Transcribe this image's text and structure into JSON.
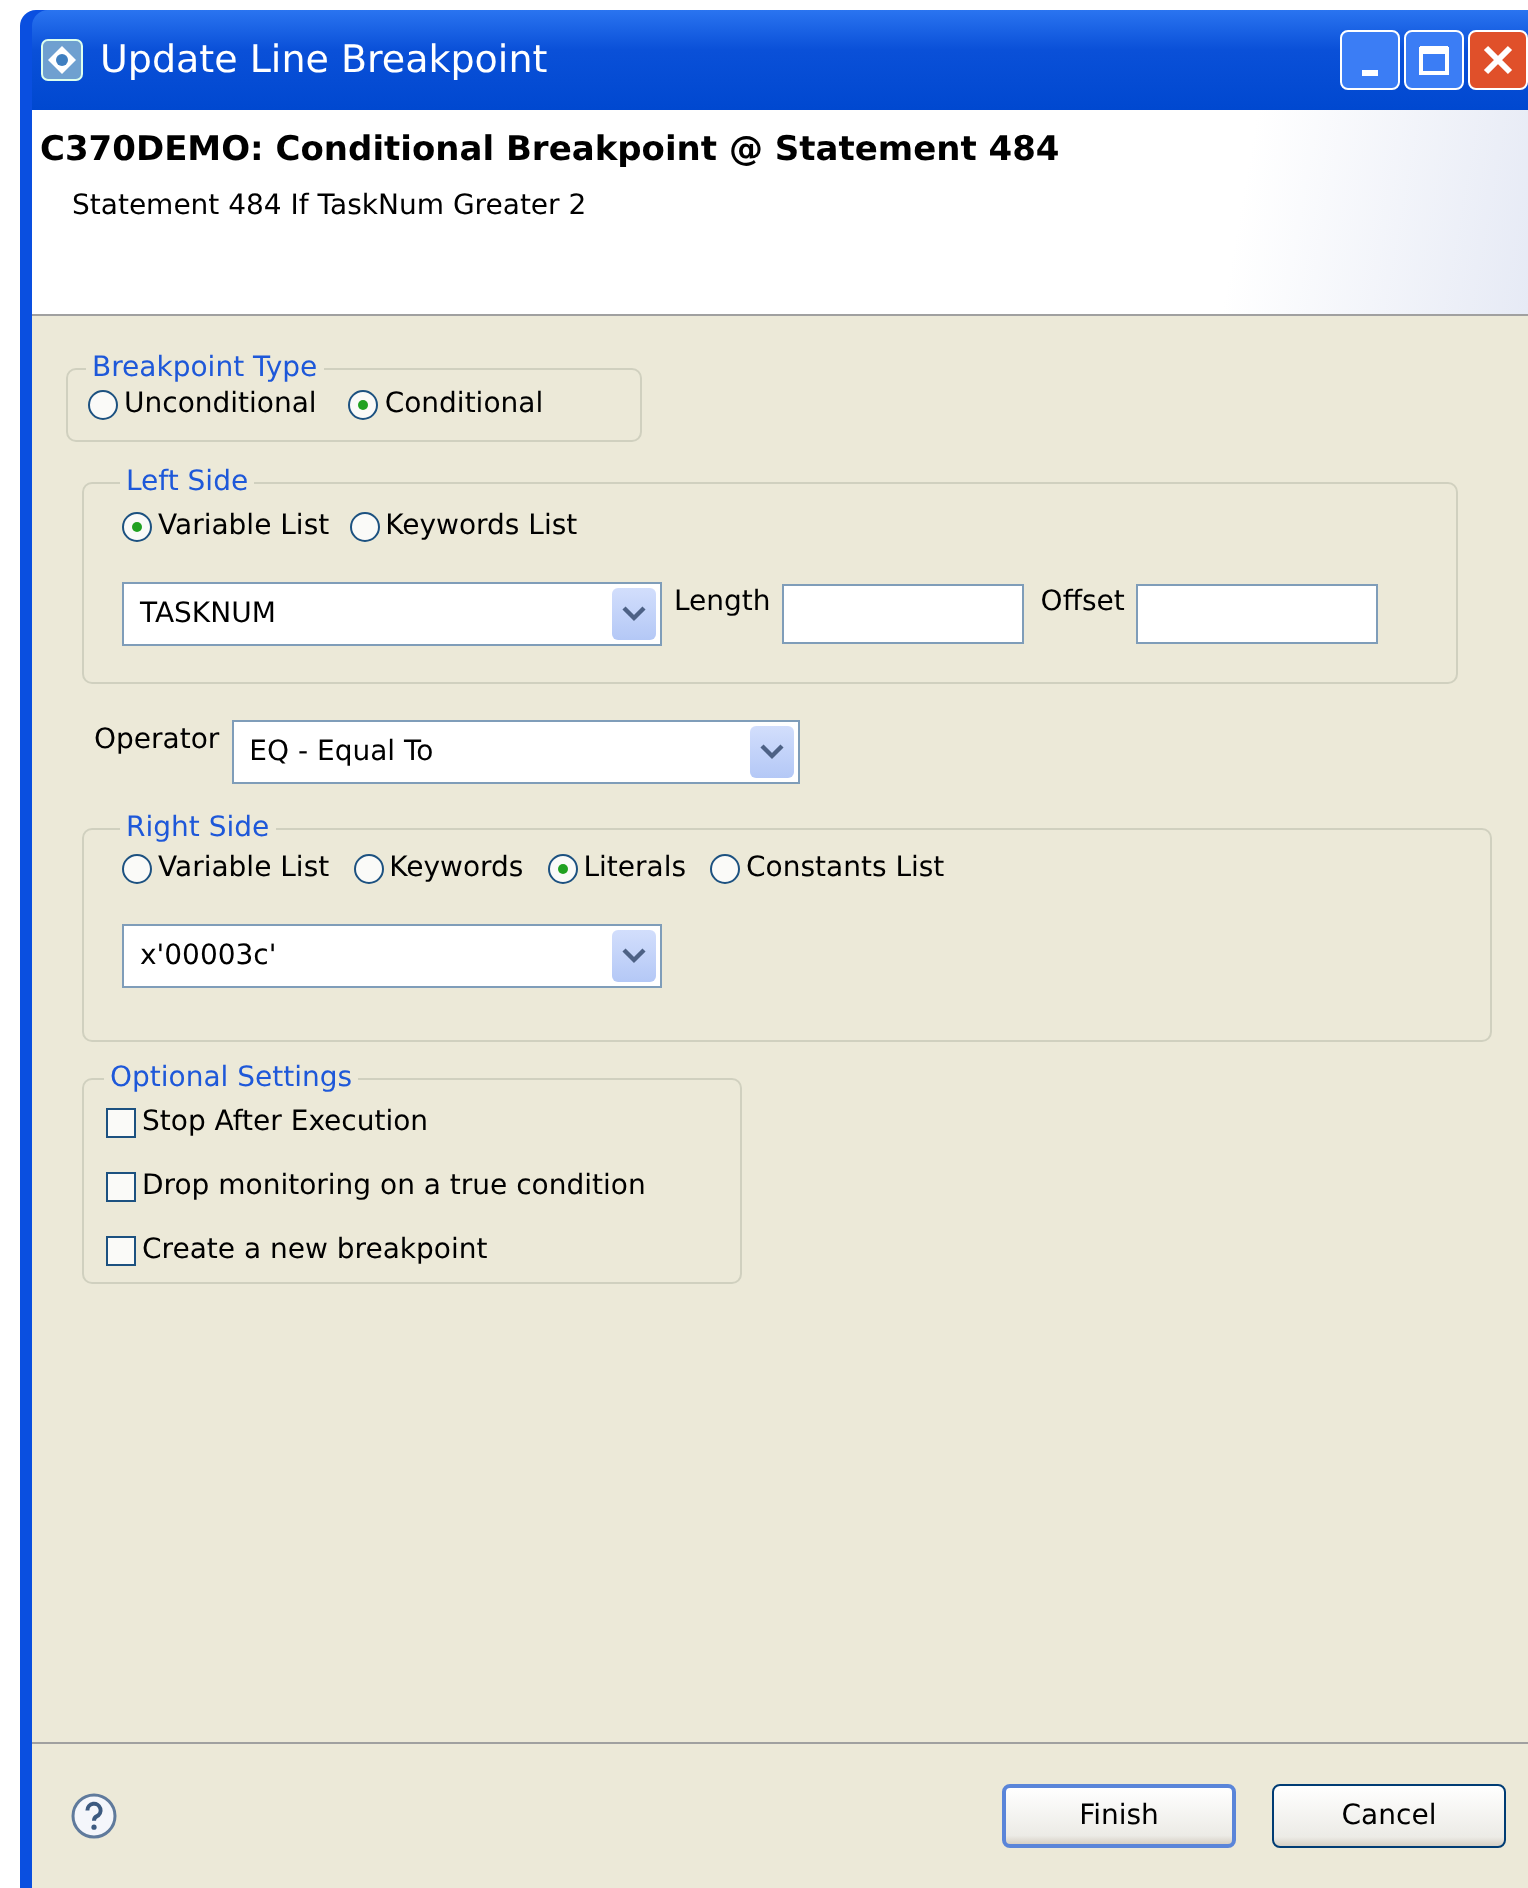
{
  "window": {
    "title": "Update Line Breakpoint"
  },
  "header": {
    "title": "C370DEMO: Conditional Breakpoint @ Statement 484",
    "description": "Statement 484 If TaskNum Greater 2"
  },
  "breakpoint_type": {
    "label": "Breakpoint Type",
    "options": [
      {
        "label": "Unconditional",
        "selected": false
      },
      {
        "label": "Conditional",
        "selected": true
      }
    ]
  },
  "left_side": {
    "label": "Left Side",
    "options": [
      {
        "label": "Variable List",
        "selected": true
      },
      {
        "label": "Keywords List",
        "selected": false
      }
    ],
    "value": "TASKNUM",
    "length_label": "Length",
    "offset_label": "Offset"
  },
  "operator": {
    "label": "Operator",
    "value": "EQ - Equal To"
  },
  "right_side": {
    "label": "Right Side",
    "options": [
      {
        "label": "Variable List",
        "selected": false
      },
      {
        "label": "Keywords",
        "selected": false
      },
      {
        "label": "Literals",
        "selected": true
      },
      {
        "label": "Constants List",
        "selected": false
      }
    ],
    "value": "x'00003c'"
  },
  "optional_settings": {
    "label": "Optional Settings",
    "options": [
      {
        "label": "Stop After Execution",
        "checked": false
      },
      {
        "label": "Drop monitoring on a true condition",
        "checked": false
      },
      {
        "label": "Create a new breakpoint",
        "checked": false
      }
    ]
  },
  "buttons": [
    {
      "label": "Finish",
      "default": true
    },
    {
      "label": "Cancel",
      "default": false
    }
  ]
}
